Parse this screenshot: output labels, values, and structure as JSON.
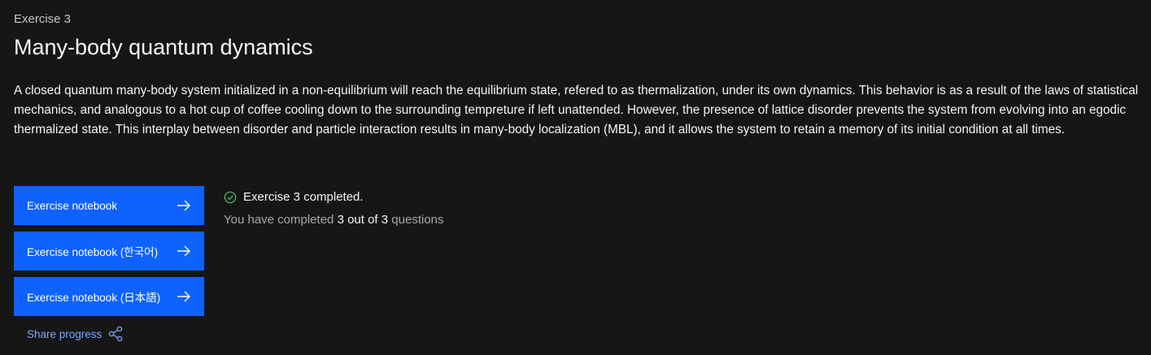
{
  "exercise": {
    "eyebrow": "Exercise 3",
    "title": "Many-body quantum dynamics",
    "description": "A closed quantum many-body system initialized in a non-equilibrium will reach the equilibrium state, refered to as thermalization, under its own dynamics. This behavior is as a result of the laws of statistical mechanics, and analogous to a hot cup of coffee cooling down to the surrounding tempreture if left unattended. However, the presence of lattice disorder prevents the system from evolving into an egodic thermalized state. This interplay between disorder and particle interaction results in many-body localization (MBL), and it allows the system to retain a memory of its initial condition at all times."
  },
  "buttons": [
    {
      "label": "Exercise notebook",
      "icon": "arrow-right-icon"
    },
    {
      "label": "Exercise notebook (한국어)",
      "icon": "arrow-right-icon"
    },
    {
      "label": "Exercise notebook (日本語)",
      "icon": "arrow-right-icon"
    }
  ],
  "share": {
    "label": "Share progress",
    "icon": "share-icon"
  },
  "status": {
    "icon": "checkmark-circle-icon",
    "completed_text": "Exercise 3 completed.",
    "progress_prefix": "You have completed",
    "progress_value": "3 out of 3",
    "progress_suffix": "questions"
  },
  "colors": {
    "background": "#161616",
    "primary_button": "#0f62fe",
    "link": "#78a9ff",
    "success": "#42be65",
    "text": "#f4f4f4",
    "muted_text": "#a8a8a8"
  }
}
